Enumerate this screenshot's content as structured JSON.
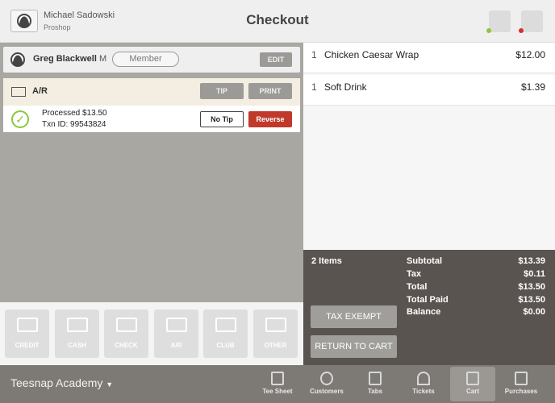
{
  "header": {
    "user_name": "Michael Sadowski",
    "user_role": "Proshop",
    "title": "Checkout",
    "status_colors": {
      "printer": "#8dc63f",
      "drawer": "#d0312d"
    }
  },
  "customer": {
    "name": "Greg Blackwell",
    "suffix": "M",
    "badge": "Member",
    "edit_label": "EDIT"
  },
  "payment": {
    "method": "A/R",
    "tip_label": "TIP",
    "print_label": "PRINT",
    "processed": "Processed $13.50",
    "txn": "Txn ID: 99543824",
    "no_tip_label": "No Tip",
    "reverse_label": "Reverse"
  },
  "tenders": [
    "CREDIT",
    "CASH",
    "CHECK",
    "A/R",
    "CLUB",
    "OTHER"
  ],
  "cart": {
    "items": [
      {
        "qty": "1",
        "name": "Chicken Caesar Wrap",
        "price": "$12.00"
      },
      {
        "qty": "1",
        "name": "Soft Drink",
        "price": "$1.39"
      }
    ]
  },
  "summary": {
    "count": "2 Items",
    "rows": [
      {
        "label": "Subtotal",
        "value": "$13.39"
      },
      {
        "label": "Tax",
        "value": "$0.11"
      },
      {
        "label": "Total",
        "value": "$13.50"
      },
      {
        "label": "Total Paid",
        "value": "$13.50"
      },
      {
        "label": "Balance",
        "value": "$0.00"
      }
    ],
    "tax_exempt_label": "TAX EXEMPT",
    "return_label": "RETURN TO CART"
  },
  "footer": {
    "venue": "Teesnap Academy",
    "nav": [
      "Tee Sheet",
      "Customers",
      "Tabs",
      "Tickets",
      "Cart",
      "Purchases"
    ],
    "active": "Cart"
  }
}
